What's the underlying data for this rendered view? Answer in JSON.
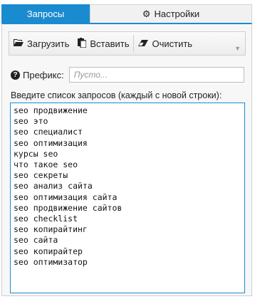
{
  "tabs": {
    "active_label": "Запросы",
    "settings_label": "Настройки"
  },
  "toolbar": {
    "load_label": "Загрузить",
    "paste_label": "Вставить",
    "clear_label": "Очистить"
  },
  "prefix": {
    "label": "Префикс:",
    "placeholder": "Пусто..."
  },
  "queries": {
    "label": "Введите список запросов (каждый с новой строки):",
    "items": [
      "seo продвижение",
      "seo это",
      "seo специалист",
      "seo оптимизация",
      "курсы seo",
      "что такое seo",
      "seo секреты",
      "seo анализ сайта",
      "seo оптимизация сайта",
      "seo продвижение сайтов",
      "seo checklist",
      "seo копирайтинг",
      "seo сайта",
      "seo копирайтер",
      "seo оптимизатор"
    ]
  },
  "colors": {
    "accent": "#1b8bd0",
    "panel_bg": "#f7f7f7"
  }
}
